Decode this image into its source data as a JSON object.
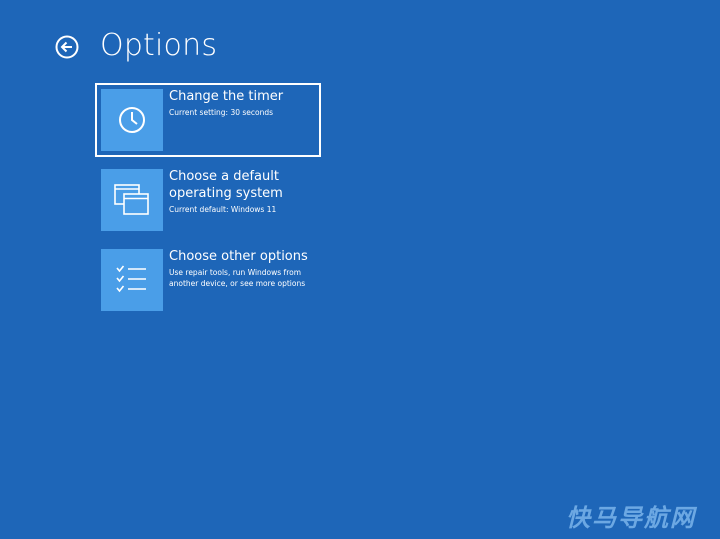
{
  "header": {
    "title": "Options",
    "back_icon": "back-arrow-icon"
  },
  "options": [
    {
      "title": "Change the timer",
      "description": "Current setting: 30 seconds",
      "icon": "clock-icon",
      "selected": true
    },
    {
      "title": "Choose a default operating system",
      "description": "Current default: Windows 11",
      "icon": "windows-stack-icon",
      "selected": false
    },
    {
      "title": "Choose other options",
      "description": "Use repair tools, run Windows from another device, or see more options",
      "icon": "checklist-icon",
      "selected": false
    }
  ],
  "watermark": {
    "text": "快马导航网"
  },
  "colors": {
    "background": "#1e66b8",
    "tile": "#4a9ee8",
    "text": "#ffffff",
    "selection_border": "#ffffff"
  }
}
